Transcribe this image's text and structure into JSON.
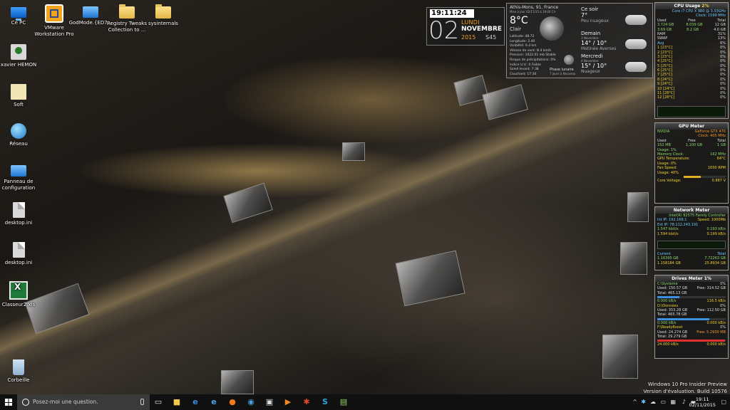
{
  "desktop": {
    "icons": [
      {
        "label": "Ce PC",
        "icon": "computer-icon"
      },
      {
        "label": "VMware Workstation Pro",
        "icon": "vmware-icon"
      },
      {
        "label": "GodMode.{ED7...",
        "icon": "control-panel-icon"
      },
      {
        "label": "Registry Tweaks Collection to ...",
        "icon": "folder-icon"
      },
      {
        "label": "sysinternals",
        "icon": "folder-icon"
      },
      {
        "label": "xavier HEMON",
        "icon": "user-folder-icon"
      },
      {
        "label": "Soft",
        "icon": "folder-icon"
      },
      {
        "label": "Réseau",
        "icon": "network-icon"
      },
      {
        "label": "Panneau de configuration",
        "icon": "control-panel-icon"
      },
      {
        "label": "desktop.ini",
        "icon": "file-icon"
      },
      {
        "label": "desktop.ini",
        "icon": "file-icon"
      },
      {
        "label": "Classeur2.xls",
        "icon": "excel-icon"
      },
      {
        "label": "Corbeille",
        "icon": "recycle-bin-icon"
      }
    ]
  },
  "clock": {
    "time": "19:11:24",
    "day_number": "02",
    "day_name": "LUNDI",
    "month": "NOVEMBRE",
    "year": "2015",
    "week": "S45"
  },
  "weather": {
    "location": "Athis-Mons, 91, France",
    "updated": "Mise à jour 02/11/15 à 19:04 Clr",
    "temperature": "8°C",
    "condition": "Clair",
    "details": [
      "Latitude: 48.72",
      "Longitude: 2.40",
      "Visibilité: 9.4 km",
      "Vitesse de vent: N 4 km/h",
      "Pression: 1022.01 mb Stable",
      "Risque de précipitations: 0%",
      "Indice U.V.: 0 Faible",
      "Soleil levant: 7:38",
      "Couchant: 17:30"
    ],
    "moon_phase": "Phase lunaire",
    "moon_age": "7 jours à Nouveau",
    "forecast": [
      {
        "title": "Ce soir",
        "date": "",
        "temp": "7°",
        "cond": "Peu nuageux"
      },
      {
        "title": "Demain",
        "date": "3 Novembre",
        "temp": "14° / 10°",
        "cond": "Matinée Averses"
      },
      {
        "title": "Mercredi",
        "date": "4 Novembre",
        "temp": "15° / 10°",
        "cond": "Nuageux"
      }
    ]
  },
  "cpu": {
    "title": "CPU Usage",
    "percent": "2%",
    "model": "Core i7 CPU X 980 @ 3.33GHz",
    "clock": "Clock: 1599 MHz",
    "ram_row": {
      "a": "Used",
      "b": "Free",
      "c": "Total"
    },
    "mem1": {
      "a": "3.724 GB",
      "b": "8.039 GB",
      "c": "12 GB"
    },
    "mem2": {
      "a": "3.69 GB",
      "b": "8.2 GB",
      "c": "4.0 GB"
    },
    "usage_rows": [
      {
        "label": "RAM",
        "value": "31%"
      },
      {
        "label": "SWAP",
        "value": "13%"
      },
      {
        "label": "Avg",
        "value": "6%"
      }
    ],
    "cores": [
      {
        "label": "1 [23°C]",
        "value": "0%"
      },
      {
        "label": "2 [23°C]",
        "value": "0%"
      },
      {
        "label": "3 [23°C]",
        "value": "0%"
      },
      {
        "label": "4 [25°C]",
        "value": "0%"
      },
      {
        "label": "5 [25°C]",
        "value": "0%"
      },
      {
        "label": "6 [25°C]",
        "value": "0%"
      },
      {
        "label": "7 [25°C]",
        "value": "0%"
      },
      {
        "label": "8 [24°C]",
        "value": "0%"
      },
      {
        "label": "9 [24°C]",
        "value": "0%"
      },
      {
        "label": "10 [24°C]",
        "value": "0%"
      },
      {
        "label": "11 [28°C]",
        "value": "0%"
      },
      {
        "label": "12 [28°C]",
        "value": "0%"
      }
    ]
  },
  "gpu": {
    "title": "GPU Meter",
    "brand": "NVIDIA",
    "model": "GeForce GTX 470",
    "clock": "Clock: 405 MHz",
    "mem_header": {
      "a": "Used",
      "b": "Free",
      "c": "Total"
    },
    "mem_values": {
      "a": "152 MB",
      "b": "1,100 GB",
      "c": "1 GB"
    },
    "usage": "Usage: 1%",
    "mem_clock_label": "Memory Clock:",
    "mem_clock_value": "162 MHz",
    "gpu_temp_label": "GPU Temperature:",
    "gpu_temp_value": "64°C",
    "usage2": "Usage: 0%",
    "fan_label": "Fan Speed:",
    "fan_value": "1650 RPM",
    "fan_usage": "Usage: 40%",
    "voltage_label": "Core Voltage:",
    "voltage_value": "0.887 V"
  },
  "network": {
    "title": "Network Meter",
    "ip_label": "Intel(R) 82575 Family Controller",
    "int_ip": "Int IP: 192.168.1",
    "ext_ip": "Ext IP: 78.112.243.191",
    "speed": "Speed: 1000Mb",
    "up1": "1.547 kbit/s",
    "up2": "0.193 kB/s",
    "down1": "1.594 kbit/s",
    "down2": "0.199 kB/s",
    "current_label": "Current",
    "total_label": "Total",
    "cur1": "1.16395 GB",
    "tot1": "7.72263 GB",
    "cur2": "1.158184 GB",
    "tot2": "25.8934 GB"
  },
  "drives": {
    "title": "Drives Meter",
    "percent": "1%",
    "list": [
      {
        "name": "C:\\Systeme",
        "pct": "0%",
        "used": "Used: 150.57 GB",
        "total": "Total: 465.13 GB",
        "free": "Free: 314.52 GB",
        "r": "0.000 kB/s",
        "w": "116.5 kB/s",
        "fill": 0.32
      },
      {
        "name": "D:\\Données",
        "pct": "0%",
        "used": "Used: 353.28 GB",
        "total": "Total: 465.78 GB",
        "free": "Free: 112.50 GB",
        "r": "0.000 kB/s",
        "w": "0.000 kB/s",
        "fill": 0.76
      },
      {
        "name": "F:\\ReadyBoost",
        "pct": "0%",
        "used": "Used: 24.274 GB",
        "total": "Total: 29.279 GB",
        "free": "Free: 5.2930 MB",
        "r": "24.000 kB/s",
        "w": "0.000 kB/s",
        "fill": 0.99
      }
    ]
  },
  "watermark": {
    "line1": "Windows 10 Pro Insider Preview",
    "line2": "Version d'évaluation. Build 10576"
  },
  "taskbar": {
    "search_placeholder": "Posez-moi une question.",
    "time": "19:11",
    "date": "02/11/2015",
    "pinned": [
      "task-view-icon",
      "folder-icon",
      "edge-icon",
      "ie-icon",
      "firefox-icon",
      "chrome-icon",
      "store-icon",
      "media-icon",
      "settings-icon",
      "skype-icon",
      "notepad-icon"
    ]
  }
}
